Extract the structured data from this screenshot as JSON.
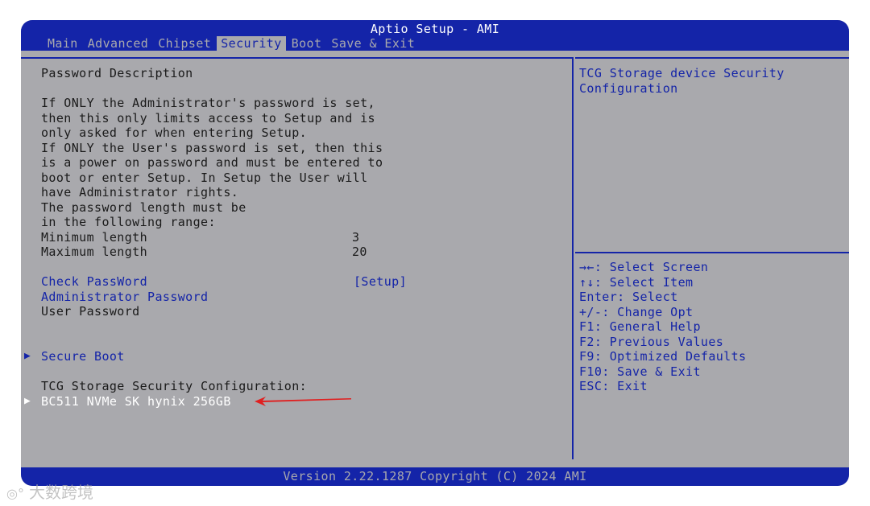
{
  "app": {
    "title": "Aptio Setup - AMI",
    "footer": "Version 2.22.1287 Copyright (C) 2024 AMI"
  },
  "tabs": [
    {
      "label": "Main"
    },
    {
      "label": "Advanced"
    },
    {
      "label": "Chipset"
    },
    {
      "label": "Security",
      "active": true
    },
    {
      "label": "Boot"
    },
    {
      "label": "Save & Exit"
    }
  ],
  "left": {
    "heading": "Password Description",
    "description": [
      "If ONLY the Administrator's password is set,",
      "then this only limits access to Setup and is",
      "only asked for when entering Setup.",
      "If ONLY the User's password is set, then this",
      "is a power on password and must be entered to",
      "boot or enter Setup. In Setup the User will",
      "have Administrator rights.",
      "The password length must be",
      "in the following range:"
    ],
    "min_label": "Minimum length",
    "min_value": "3",
    "max_label": "Maximum length",
    "max_value": "20",
    "check_password_label": "Check PassWord",
    "check_password_value": "[Setup]",
    "admin_password_label": "Administrator Password",
    "user_password_label": "User Password",
    "secure_boot_label": "Secure Boot",
    "tcg_heading": "TCG Storage Security Configuration:",
    "tcg_device_label": "BC511 NVMe SK hynix 256GB"
  },
  "right": {
    "help_text": [
      "TCG Storage device Security",
      "Configuration"
    ],
    "keys": [
      "→←: Select Screen",
      "↑↓: Select Item",
      "Enter: Select",
      "+/-: Change Opt",
      "F1: General Help",
      "F2: Previous Values",
      "F9: Optimized Defaults",
      "F10: Save & Exit",
      "ESC: Exit"
    ]
  },
  "colors": {
    "bios_blue": "#1424a8",
    "bios_gray": "#a9a9ad",
    "annotation_red": "#e02020"
  },
  "icons": {
    "submenu_marker": "triangle-right-icon",
    "annotation": "red-arrow-icon"
  },
  "watermark": {
    "text": "大数跨境"
  }
}
